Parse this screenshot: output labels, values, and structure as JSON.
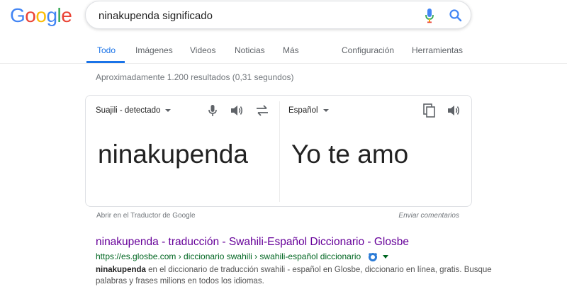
{
  "logo": {
    "letters": [
      {
        "char": "G",
        "color": "#4285F4"
      },
      {
        "char": "o",
        "color": "#EA4335"
      },
      {
        "char": "o",
        "color": "#FBBC05"
      },
      {
        "char": "g",
        "color": "#4285F4"
      },
      {
        "char": "l",
        "color": "#34A853"
      },
      {
        "char": "e",
        "color": "#EA4335"
      }
    ]
  },
  "search": {
    "value": "ninakupenda significado",
    "mic_icon": "mic-icon",
    "search_icon": "search-icon"
  },
  "tabs": {
    "todo": "Todo",
    "imagenes": "Imágenes",
    "videos": "Videos",
    "noticias": "Noticias",
    "mas": "Más",
    "configuracion": "Configuración",
    "herramientas": "Herramientas"
  },
  "result_stats": "Aproximadamente 1.200 resultados (0,31 segundos)",
  "translator": {
    "source_lang": "Suajili - detectado",
    "target_lang": "Español",
    "source_text": "ninakupenda",
    "target_text": "Yo te amo",
    "open_link": "Abrir en el Traductor de Google",
    "feedback_link": "Enviar comentarios"
  },
  "result": {
    "title": "ninakupenda - traducción - Swahili-Español Diccionario - Glosbe",
    "url": "https://es.glosbe.com › diccionario swahili › swahili-español diccionario",
    "snippet_bold": "ninakupenda",
    "snippet_rest": " en el diccionario de traducción swahili - español en Glosbe, diccionario en línea, gratis. Busque palabras y frases milions en todos los idiomas."
  },
  "colors": {
    "accent_blue": "#1a73e8",
    "visited_link": "#660099",
    "url_green": "#006621"
  }
}
